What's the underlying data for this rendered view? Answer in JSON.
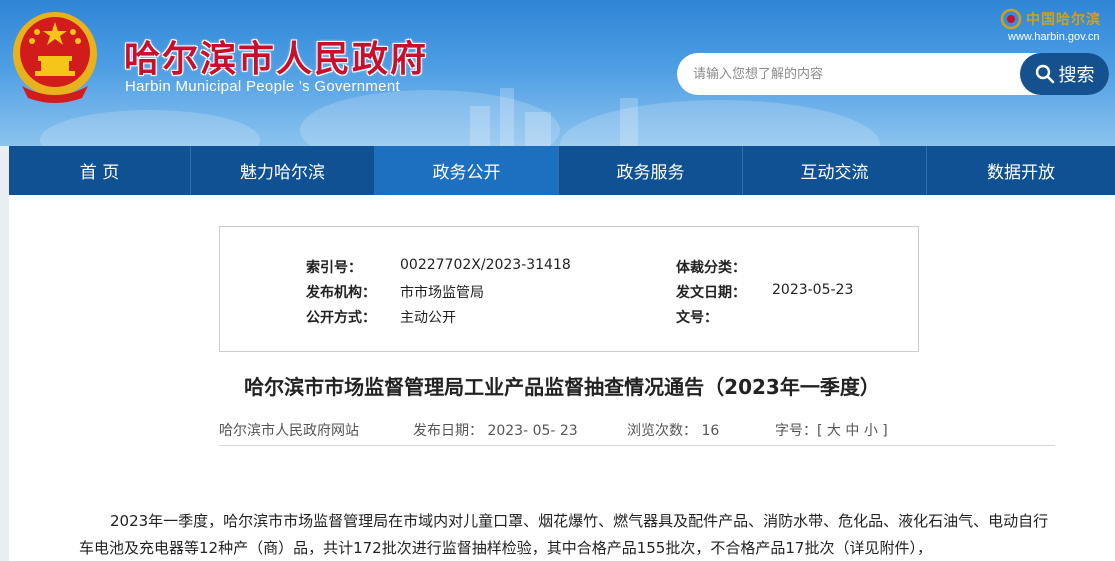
{
  "header": {
    "title": "哈尔滨市人民政府",
    "subtitle": "Harbin Municipal People 's Government",
    "china_logo_text": "中国哈尔滨",
    "china_url": "www.harbin.gov.cn",
    "emblem_icon": "national-emblem-icon"
  },
  "search": {
    "placeholder": "请输入您想了解的内容",
    "value": "",
    "button_label": "搜索",
    "icon": "search-icon"
  },
  "nav": {
    "items": [
      {
        "label": "首 页"
      },
      {
        "label": "魅力哈尔滨"
      },
      {
        "label": "政务公开"
      },
      {
        "label": "政务服务"
      },
      {
        "label": "互动交流"
      },
      {
        "label": "数据开放"
      }
    ],
    "active_index": 2
  },
  "meta": {
    "index_label": "索引号：",
    "index_value": "00227702X/2023-31418",
    "genre_label": "体裁分类：",
    "genre_value": "",
    "publisher_label": "发布机构：",
    "publisher_value": "市市场监管局",
    "doc_date_label": "发文日期：",
    "doc_date_value": "2023-05-23",
    "disclosure_label": "公开方式：",
    "disclosure_value": "主动公开",
    "doc_no_label": "文号：",
    "doc_no_value": ""
  },
  "article": {
    "title": "哈尔滨市市场监督管理局工业产品监督抽查情况通告（2023年一季度）",
    "source": "哈尔滨市人民政府网站",
    "publish_date": "发布日期：  2023- 05- 23",
    "views": "浏览次数：  16",
    "font_size_label": "字号：[",
    "size_large": "大",
    "size_medium": "中",
    "size_small": "小",
    "font_size_end": "]",
    "paragraph": "2023年一季度，哈尔滨市市场监督管理局在市域内对儿童口罩、烟花爆竹、燃气器具及配件产品、消防水带、危化品、液化石油气、电动自行车电池及充电器等12种产（商）品，共计172批次进行监督抽样检验，其中合格产品155批次，不合格产品17批次（详见附件），"
  },
  "colors": {
    "nav_bg": "#0f5192",
    "nav_active": "#1d6fbf",
    "title_red": "#c8102e",
    "search_btn": "#15508f"
  }
}
